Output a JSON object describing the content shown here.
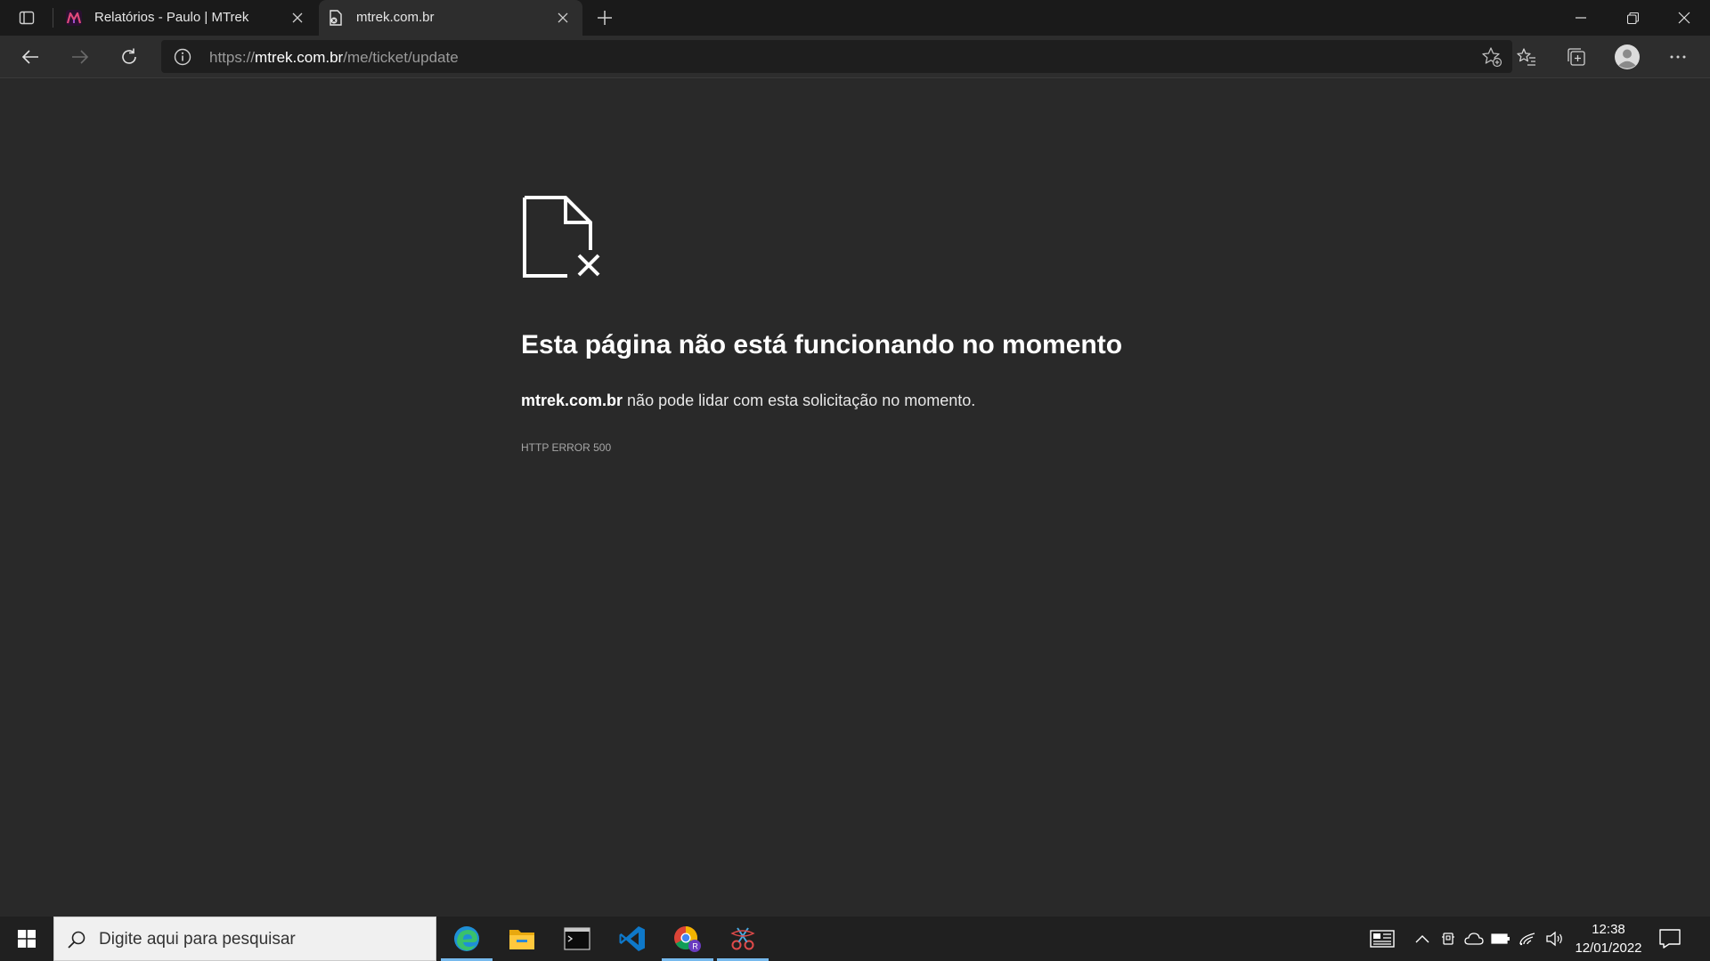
{
  "browser": {
    "tabs": [
      {
        "title": "Relatórios - Paulo | MTrek",
        "active": false
      },
      {
        "title": "mtrek.com.br",
        "active": true
      }
    ],
    "address": {
      "scheme": "https://",
      "host": "mtrek.com.br",
      "path": "/me/ticket/update"
    }
  },
  "error_page": {
    "title": "Esta página não está funcionando no momento",
    "host": "mtrek.com.br",
    "message": " não pode lidar com esta solicitação no momento.",
    "code": "HTTP ERROR 500"
  },
  "taskbar": {
    "search_placeholder": "Digite aqui para pesquisar",
    "apps": [
      "edge-icon",
      "file-explorer-icon",
      "terminal-icon",
      "vscode-icon",
      "chrome-profile-icon",
      "snipping-tool-icon"
    ],
    "time": "12:38",
    "date": "12/01/2022"
  },
  "colors": {
    "page_bg": "#292929",
    "tabbar_bg": "#1a1a1a",
    "toolbar_bg": "#2d2d2d",
    "taskbar_bg": "#202020",
    "accent": "#76b9ed"
  }
}
